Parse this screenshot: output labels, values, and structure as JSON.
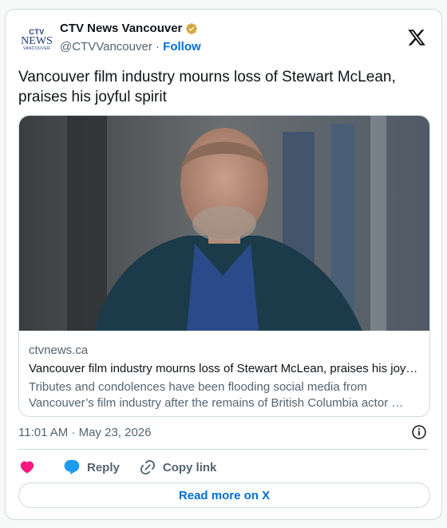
{
  "account": {
    "name": "CTV News Vancouver",
    "handle": "@CTVVancouver",
    "separator": "·",
    "follow_label": "Follow",
    "avatar_logo": {
      "top": "CTV",
      "main": "NEWS",
      "sub": "VANCOUVER"
    },
    "verified_icon": "gold-verified-badge-icon",
    "verified_color": "#d2a740"
  },
  "platform_icon": "x-logo-icon",
  "tweet": {
    "text": "Vancouver film industry mourns loss of Stewart McLean, praises his joyful spirit"
  },
  "link_card": {
    "image": "portrait-photo",
    "domain": "ctvnews.ca",
    "title": "Vancouver film industry mourns loss of Stewart McLean, praises his joy…",
    "description": "Tributes and condolences have been flooding social media from Vancouver’s film industry after the remains of British Columbia actor …"
  },
  "meta": {
    "timestamp": "11:01 AM · May 23, 2026",
    "info_icon": "info-icon"
  },
  "actions": {
    "like_icon": "heart-icon",
    "reply_label": "Reply",
    "copy_link_label": "Copy link"
  },
  "read_more_label": "Read more on X",
  "colors": {
    "accent": "#006fd6",
    "heart": "#f91880",
    "muted": "#536471",
    "border": "#cfd9de"
  }
}
